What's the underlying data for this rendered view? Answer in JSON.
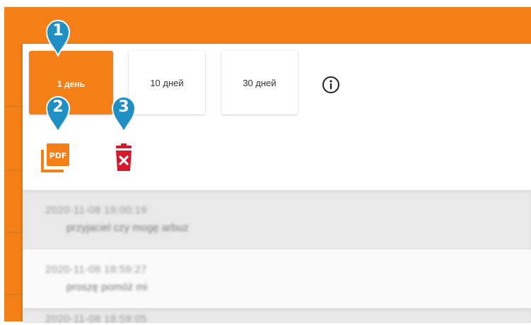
{
  "range_buttons": [
    {
      "label": "1 день",
      "active": true
    },
    {
      "label": "10 дней",
      "active": false
    },
    {
      "label": "30 дней",
      "active": false
    }
  ],
  "icons": {
    "info": "info-icon",
    "pdf": "pdf-export-icon",
    "pdf_text": "PDF",
    "trash": "trash-icon"
  },
  "markers": [
    "1",
    "2",
    "3"
  ],
  "history": [
    {
      "timestamp": "2020-11-08 19:00:19",
      "message": "przyjaciel czy mogę arbuz"
    },
    {
      "timestamp": "2020-11-08 18:59:27",
      "message": "proszę pomóż mi"
    },
    {
      "timestamp": "2020-11-08 18:59:05",
      "message": ""
    }
  ],
  "colors": {
    "accent": "#f47f16",
    "marker": "#1f8fc4",
    "delete": "#d7192d"
  }
}
